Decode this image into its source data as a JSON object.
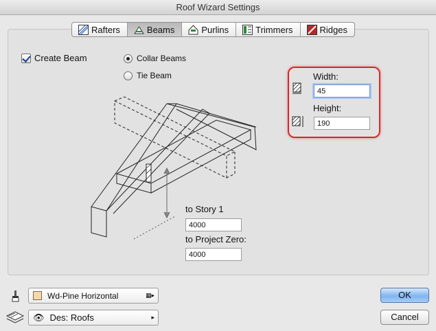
{
  "window": {
    "title": "Roof Wizard Settings"
  },
  "tabs": [
    {
      "label": "Rafters",
      "icon": "rafters-icon"
    },
    {
      "label": "Beams",
      "icon": "beams-icon",
      "active": true
    },
    {
      "label": "Purlins",
      "icon": "purlins-icon"
    },
    {
      "label": "Trimmers",
      "icon": "trimmers-icon"
    },
    {
      "label": "Ridges",
      "icon": "ridges-icon"
    }
  ],
  "beam": {
    "create_label": "Create Beam",
    "create_checked": true,
    "collar_label": "Collar Beams",
    "tie_label": "Tie Beam",
    "selected_type": "Collar Beams"
  },
  "dimensions": {
    "width_label": "Width:",
    "width_value": "45",
    "height_label": "Height:",
    "height_value": "190"
  },
  "elevation": {
    "story_label": "to Story 1",
    "story_value": "4000",
    "zero_label": "to Project Zero:",
    "zero_value": "4000"
  },
  "material": {
    "label": "Wd-Pine Horizontal",
    "icon": "paintbrush-icon",
    "swatch_color": "#f6d9a8"
  },
  "layer": {
    "label": "Des: Roofs",
    "icon": "layers-icon"
  },
  "buttons": {
    "ok": "OK",
    "cancel": "Cancel"
  },
  "colors": {
    "highlight": "#d9252b",
    "default_button": "#7fb6ef"
  }
}
